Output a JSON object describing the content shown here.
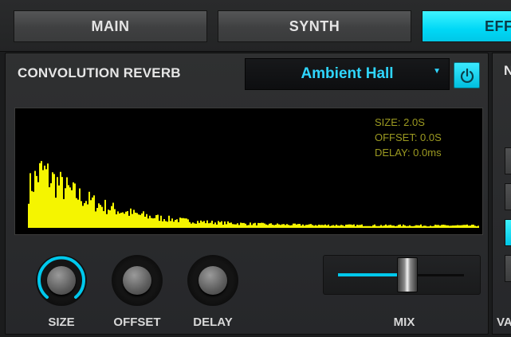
{
  "tabs": [
    {
      "label": "MAIN",
      "active": false
    },
    {
      "label": "SYNTH",
      "active": false
    },
    {
      "label": "EFF",
      "active": true
    }
  ],
  "reverb": {
    "title": "CONVOLUTION REVERB",
    "preset": "Ambient Hall",
    "power_on": true,
    "readout": {
      "size": "SIZE: 2.0S",
      "offset": "OFFSET: 0.0S",
      "delay": "DELAY: 0.0ms"
    },
    "knobs": {
      "size": {
        "label": "SIZE",
        "active": true,
        "value": 0.72
      },
      "offset": {
        "label": "OFFSET",
        "active": false,
        "value": 0.0
      },
      "delay": {
        "label": "DELAY",
        "active": false,
        "value": 0.0
      }
    },
    "mix": {
      "label": "MIX",
      "value": 0.55
    }
  },
  "right_panel": {
    "title": "N",
    "label": "VA",
    "buttons": [
      false,
      false,
      true,
      false
    ]
  },
  "colors": {
    "accent": "#00d8f6",
    "waveform": "#f5f500",
    "readout": "#9c9a21"
  },
  "icons": {
    "power": "power-icon",
    "dropdown": "triangle-down-icon"
  }
}
